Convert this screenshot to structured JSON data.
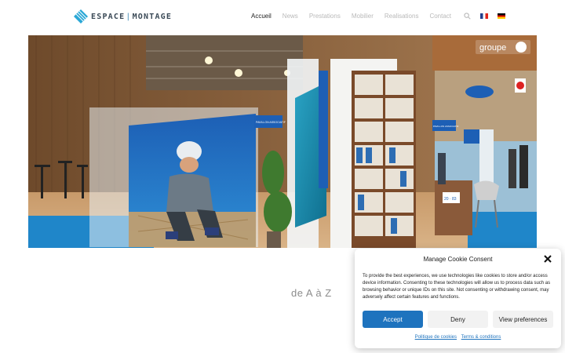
{
  "header": {
    "logo": {
      "word1": "ESPACE",
      "word2": "MONTAGE"
    },
    "nav": [
      {
        "label": "Accueil",
        "active": true
      },
      {
        "label": "News",
        "active": false
      },
      {
        "label": "Prestations",
        "active": false
      },
      {
        "label": "Mobilier",
        "active": false
      },
      {
        "label": "Realisations",
        "active": false
      },
      {
        "label": "Contact",
        "active": false
      }
    ],
    "icons": [
      "search-icon",
      "flag-fr-icon",
      "flag-de-icon"
    ]
  },
  "hero": {
    "signs": {
      "groupe": "groupe",
      "pavillon_left": "PAVILLON ASSOCIATIF",
      "pavillon_right": "PAVILLON ASSOCIATIF",
      "price": "20 · 83"
    }
  },
  "tagline": "de A à Z",
  "cookie": {
    "title": "Manage Cookie Consent",
    "text": "To provide the best experiences, we use technologies like cookies to store and/or access device information. Consenting to these technologies will allow us to process data such as browsing behavior or unique IDs on this site. Not consenting or withdrawing consent, may adversely affect certain features and functions.",
    "accept": "Accept",
    "deny": "Deny",
    "preferences": "View preferences",
    "link1": "Politique de cookies",
    "link2": "Terms & conditions"
  },
  "colors": {
    "accent": "#1e73be",
    "nav_active": "#222222",
    "nav_inactive": "#b9b9b9"
  }
}
